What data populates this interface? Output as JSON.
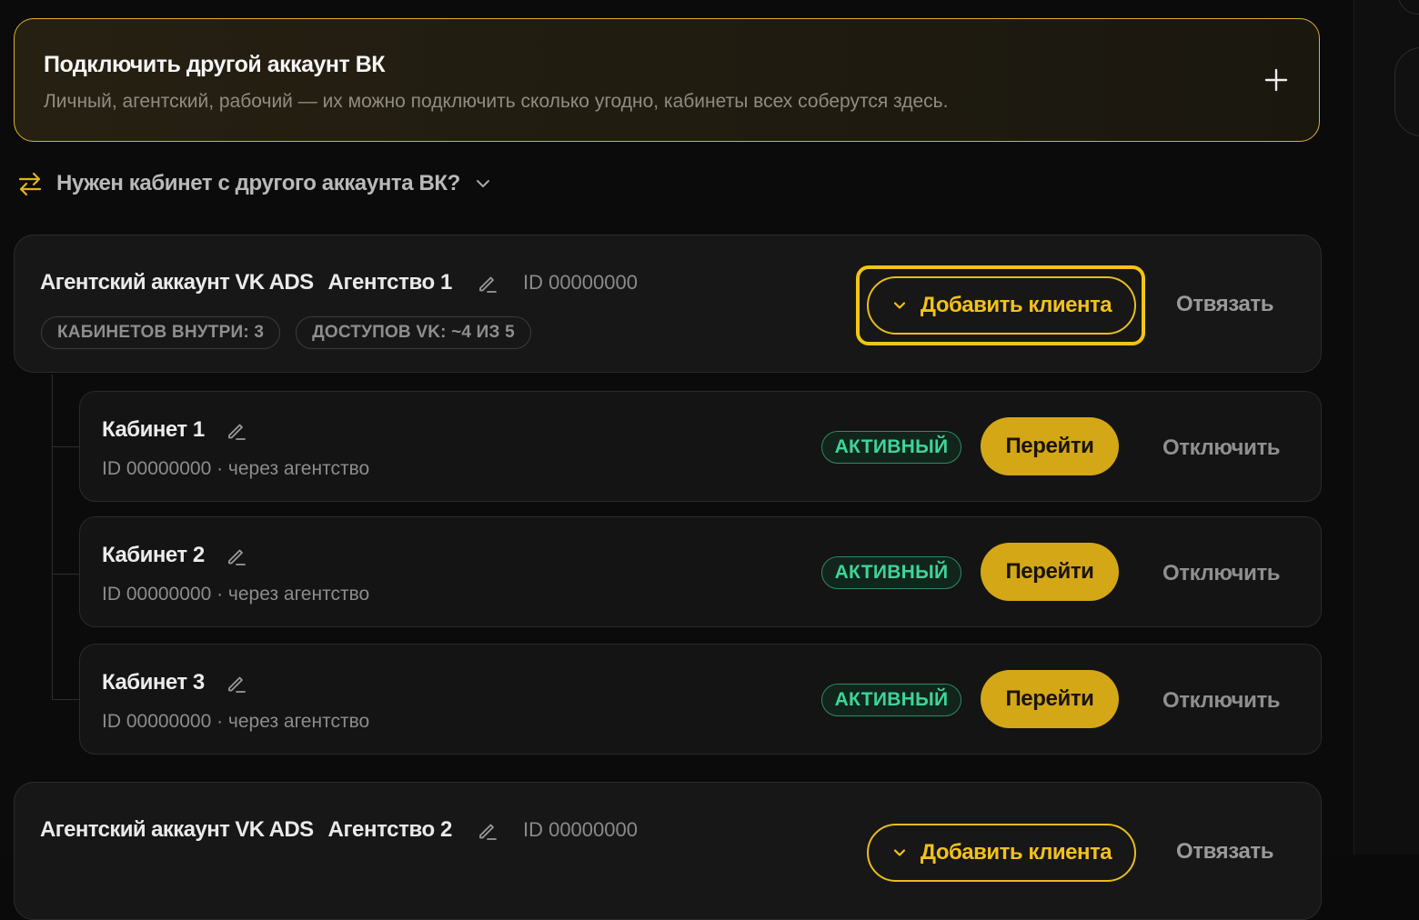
{
  "colors": {
    "accent": "#f2c11a",
    "active": "#3dd598",
    "background": "#0b0b0b"
  },
  "connect": {
    "title": "Подключить другой аккаунт ВК",
    "subtitle": "Личный, агентский, рабочий — их можно подключить сколько угодно, кабинеты всех соберутся здесь.",
    "plus_icon": "plus-icon"
  },
  "other_account": {
    "label": "Нужен кабинет с другого аккаунта ВК?",
    "icon": "swap-arrows-icon"
  },
  "agencies": [
    {
      "type_label": "Агентский аккаунт VK ADS",
      "name": "Агентство 1",
      "id_label": "ID 00000000",
      "pills": [
        "КАБИНЕТОВ ВНУТРИ: 3",
        "ДОСТУПОВ VK: ~4 ИЗ 5"
      ],
      "add_client_label": "Добавить клиента",
      "unlink_label": "Отвязать",
      "cabinets": [
        {
          "name": "Кабинет 1",
          "sub": "ID 00000000 · через агентство",
          "status": "АКТИВНЫЙ",
          "go_label": "Перейти",
          "disconnect_label": "Отключить"
        },
        {
          "name": "Кабинет 2",
          "sub": "ID 00000000 · через агентство",
          "status": "АКТИВНЫЙ",
          "go_label": "Перейти",
          "disconnect_label": "Отключить"
        },
        {
          "name": "Кабинет 3",
          "sub": "ID 00000000 · через агентство",
          "status": "АКТИВНЫЙ",
          "go_label": "Перейти",
          "disconnect_label": "Отключить"
        }
      ]
    },
    {
      "type_label": "Агентский аккаунт VK ADS",
      "name": "Агентство 2",
      "id_label": "ID 00000000",
      "add_client_label": "Добавить клиента",
      "unlink_label": "Отвязать"
    }
  ]
}
